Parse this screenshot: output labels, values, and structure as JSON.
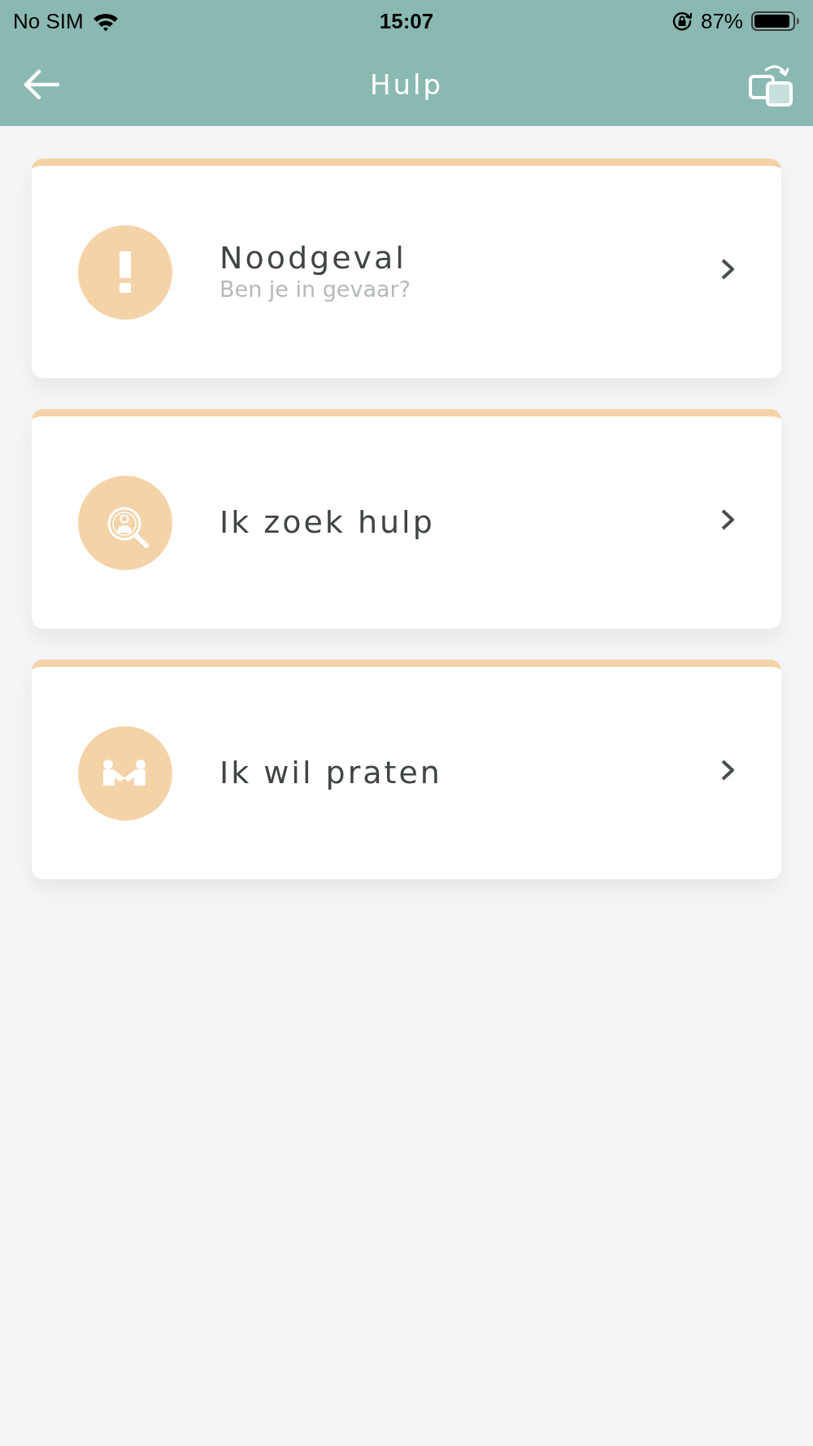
{
  "status_bar": {
    "carrier": "No SIM",
    "time": "15:07",
    "battery": "87%"
  },
  "header": {
    "title": "Hulp"
  },
  "cards": [
    {
      "kind": "alert",
      "title": "Noodgeval",
      "subtitle": "Ben je in gevaar?"
    },
    {
      "kind": "search-person",
      "title": "Ik zoek hulp"
    },
    {
      "kind": "handshake",
      "title": "Ik wil praten"
    }
  ]
}
